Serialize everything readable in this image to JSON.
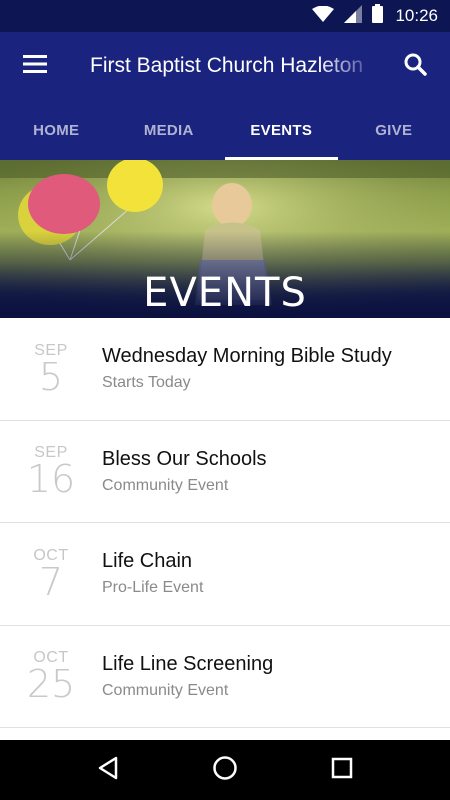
{
  "status_bar": {
    "time": "10:26",
    "icons": [
      "wifi-icon",
      "cell-signal-icon",
      "battery-icon"
    ]
  },
  "app_bar": {
    "title": "First Baptist Church Hazleton",
    "menu_icon": "hamburger-menu-icon",
    "search_icon": "search-icon"
  },
  "tabs": [
    {
      "label": "HOME",
      "active": false
    },
    {
      "label": "MEDIA",
      "active": false
    },
    {
      "label": "EVENTS",
      "active": true
    },
    {
      "label": "GIVE",
      "active": false
    }
  ],
  "hero": {
    "banner_title": "EVENTS"
  },
  "events": [
    {
      "month": "SEP",
      "day": "5",
      "title": "Wednesday Morning Bible Study",
      "subtitle": "Starts Today"
    },
    {
      "month": "SEP",
      "day": "16",
      "title": "Bless Our Schools",
      "subtitle": "Community Event"
    },
    {
      "month": "OCT",
      "day": "7",
      "title": "Life Chain",
      "subtitle": "Pro-Life Event"
    },
    {
      "month": "OCT",
      "day": "25",
      "title": "Life Line Screening",
      "subtitle": "Community Event"
    }
  ],
  "nav_bar": {
    "buttons": [
      "back-icon",
      "home-icon",
      "recents-icon"
    ]
  },
  "colors": {
    "primary": "#1a237e",
    "status_bar": "#0d1552",
    "date_text": "#c7c7c7",
    "subtitle_text": "#8a8a8a"
  }
}
